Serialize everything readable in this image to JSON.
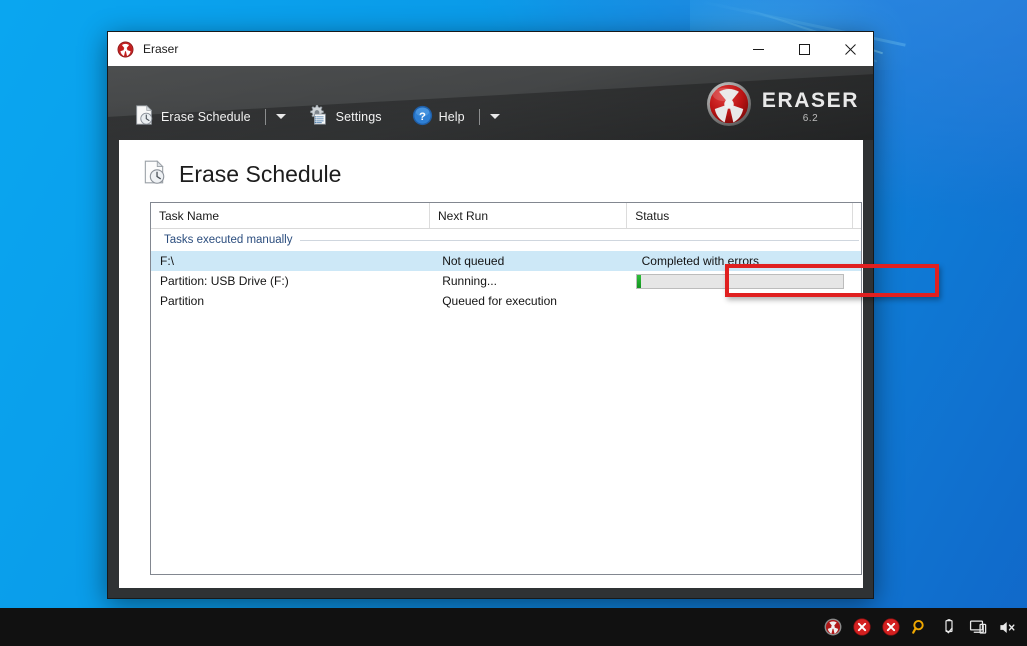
{
  "window": {
    "title": "Eraser",
    "icon": "eraser-radiation-icon",
    "controls": {
      "minimize": "minimize-icon",
      "maximize": "maximize-icon",
      "close": "close-icon"
    }
  },
  "toolbar": {
    "items": [
      {
        "label": "Erase Schedule",
        "icon": "erase-schedule-icon",
        "has_dropdown": true
      },
      {
        "label": "Settings",
        "icon": "settings-gear-icon",
        "has_dropdown": false
      },
      {
        "label": "Help",
        "icon": "help-question-icon",
        "has_dropdown": true
      }
    ],
    "brand_name": "ERASER",
    "brand_version": "6.2",
    "brand_icon": "radiation-logo-icon"
  },
  "page": {
    "title": "Erase Schedule",
    "icon": "erase-schedule-page-icon"
  },
  "task_list": {
    "columns": [
      "Task Name",
      "Next Run",
      "Status"
    ],
    "group_label": "Tasks executed manually",
    "rows": [
      {
        "task_name": "F:\\",
        "next_run": "Not queued",
        "status": "Completed with errors",
        "selected": true,
        "kind": "text"
      },
      {
        "task_name": "Partition: USB Drive (F:)",
        "next_run": "Running...",
        "status": "",
        "selected": false,
        "kind": "progress",
        "progress_percent": 2
      },
      {
        "task_name": "Partition",
        "next_run": "Queued for execution",
        "status": "",
        "selected": false,
        "kind": "text"
      }
    ]
  },
  "annotation": {
    "target": "status-cell-completed-with-errors",
    "color": "#e02020"
  },
  "taskbar": {
    "tray_icons": [
      "eraser-tray-icon",
      "error-badge-icon",
      "error-badge-icon-2",
      "search-magnifier-icon",
      "usb-safely-remove-icon",
      "network-icon",
      "volume-muted-icon"
    ]
  },
  "colors": {
    "desktop": "#0a9ae8",
    "toolbar": "#444647",
    "selection": "#cde8f7",
    "accent_red": "#c01414",
    "progress_green": "#21a52c"
  }
}
